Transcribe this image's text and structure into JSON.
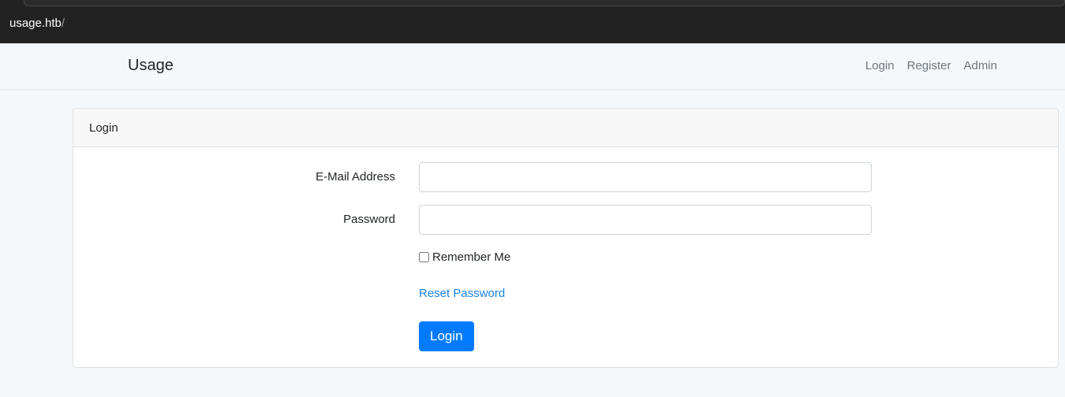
{
  "browser": {
    "url_host": "usage.htb",
    "url_path": "/"
  },
  "navbar": {
    "brand": "Usage",
    "links": [
      {
        "label": "Login"
      },
      {
        "label": "Register"
      },
      {
        "label": "Admin"
      }
    ]
  },
  "login_card": {
    "header": "Login",
    "email_label": "E-Mail Address",
    "email_value": "",
    "password_label": "Password",
    "password_value": "",
    "remember_label": "Remember Me",
    "remember_checked": false,
    "reset_link": "Reset Password",
    "submit_label": "Login"
  },
  "colors": {
    "primary": "#007bff",
    "link": "#1a82e2",
    "browser_bar": "#222222",
    "page_bg": "#f5f8fa"
  }
}
